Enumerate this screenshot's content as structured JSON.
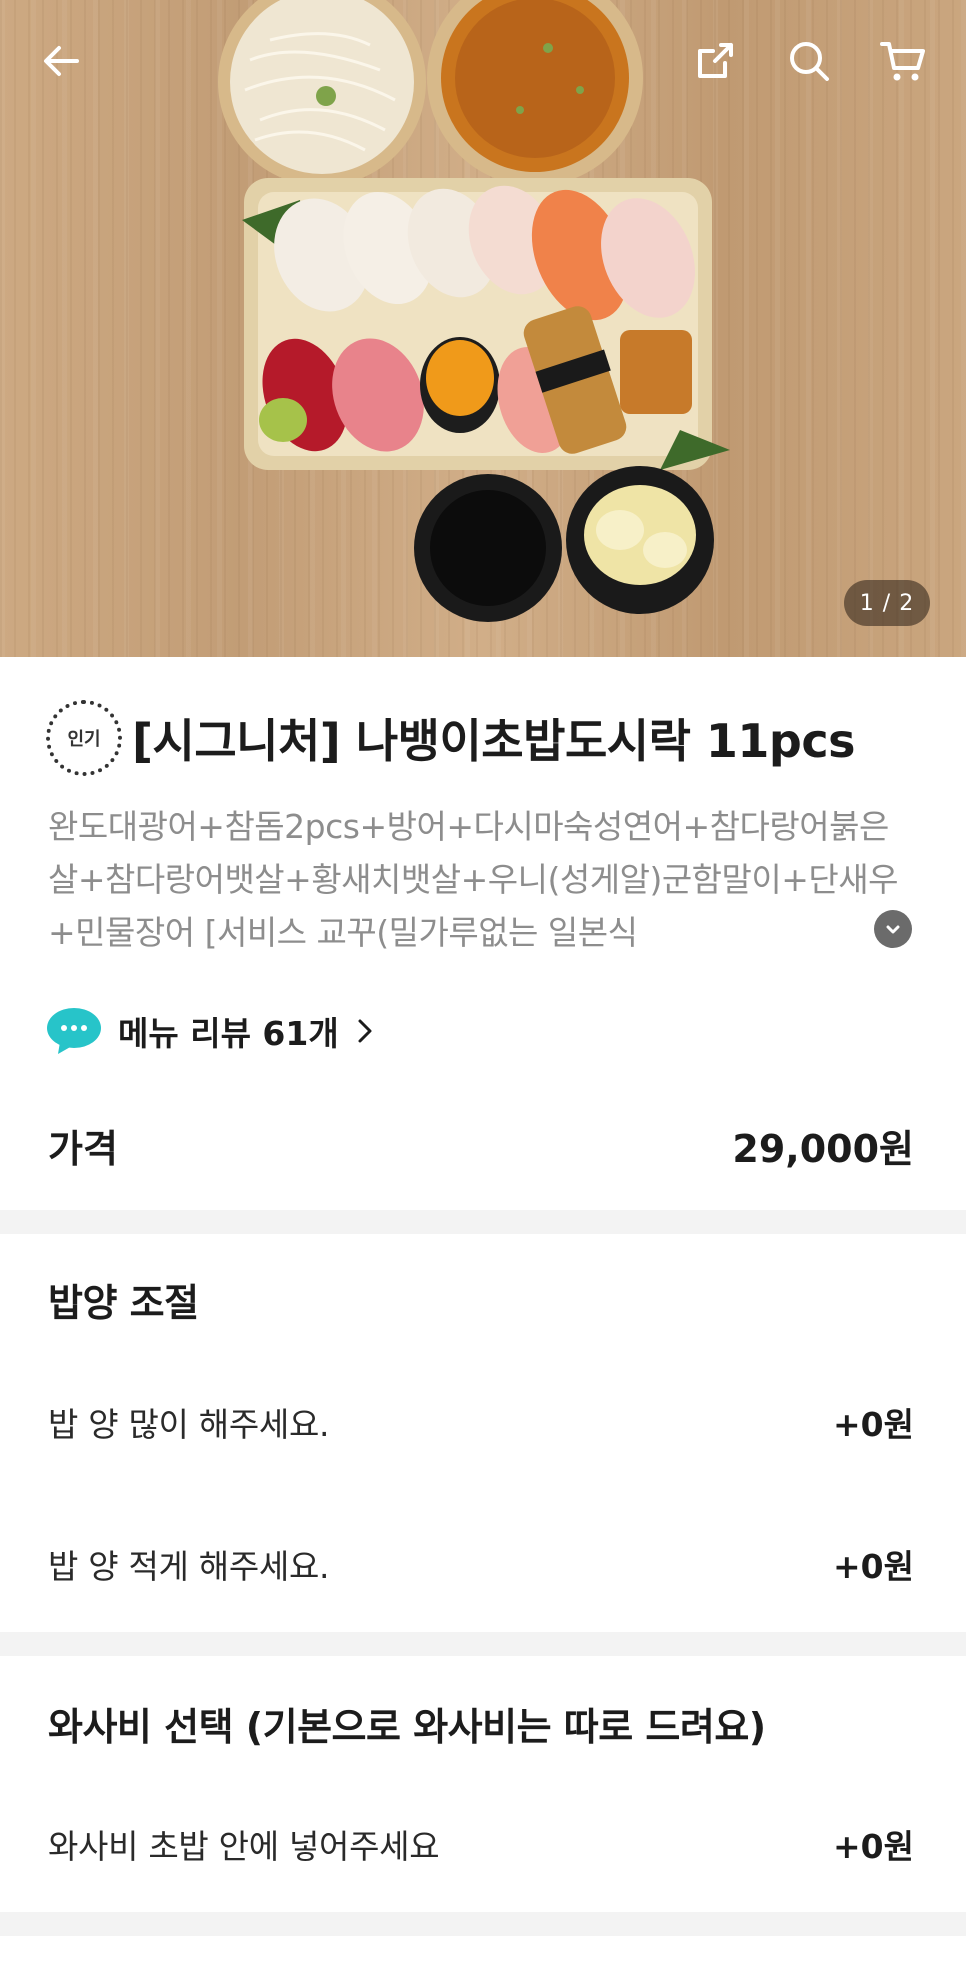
{
  "hero": {
    "page_indicator": "1 / 2",
    "icons": [
      "back-arrow-icon",
      "share-icon",
      "search-icon",
      "cart-icon"
    ]
  },
  "product": {
    "badge": "인기",
    "title": "[시그니처] 나뱅이초밥도시락 11pcs",
    "description": "완도대광어+참돔2pcs+방어+다시마숙성연어+참다랑어붉은살+참다랑어뱃살+황새치뱃살+우니(성게알)군함말이+단새우+민물장어 [서비스 교꾸(밀가루없는 일본식",
    "review_label": "메뉴 리뷰 61개",
    "price_label": "가격",
    "price_value": "29,000원"
  },
  "sections": [
    {
      "title": "밥양 조절",
      "options": [
        {
          "label": "밥 양 많이 해주세요.",
          "price": "+0원"
        },
        {
          "label": "밥 양 적게 해주세요.",
          "price": "+0원"
        }
      ]
    },
    {
      "title": "와사비 선택 (기본으로 와사비는 따로 드려요)",
      "options": [
        {
          "label": "와사비 초밥 안에 넣어주세요",
          "price": "+0원"
        }
      ]
    }
  ],
  "colors": {
    "review_icon": "#27c4c9",
    "divider": "#f3f3f3",
    "description_text": "#8d8d8d"
  }
}
